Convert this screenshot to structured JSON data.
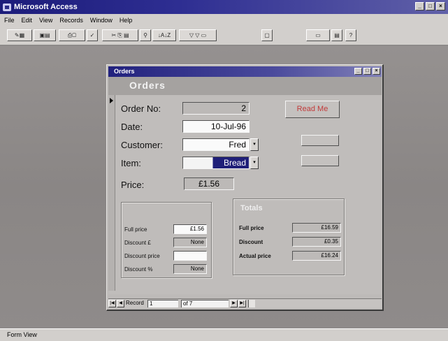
{
  "app": {
    "title": "Microsoft Access",
    "menu": [
      "File",
      "Edit",
      "View",
      "Records",
      "Window",
      "Help"
    ],
    "status": "Form View"
  },
  "form": {
    "window_title": "Orders",
    "header_title": "Orders",
    "fields": {
      "order_no": {
        "label": "Order No:",
        "value": "2"
      },
      "date": {
        "label": "Date:",
        "value": "10-Jul-96"
      },
      "customer": {
        "label": "Customer:",
        "value": "Fred"
      },
      "item": {
        "label": "Item:",
        "value": "Bread"
      },
      "price": {
        "label": "Price:",
        "value": "£1.56"
      }
    },
    "read_me_label": "Read Me",
    "left_group": {
      "rows": [
        {
          "label": "Full price",
          "value": "£1.56"
        },
        {
          "label": "Discount £",
          "value": "None"
        },
        {
          "label": "Discount price",
          "value": ""
        },
        {
          "label": "Discount %",
          "value": "None"
        }
      ]
    },
    "totals": {
      "title": "Totals",
      "rows": [
        {
          "label": "Full price",
          "value": "£16.59"
        },
        {
          "label": "Discount",
          "value": "£0.35"
        },
        {
          "label": "Actual price",
          "value": "£16.24"
        }
      ]
    },
    "navigation": {
      "record_label": "Record",
      "current": "1",
      "of_text": "of 7"
    }
  },
  "colors": {
    "title_bar": "#1c1c7a",
    "workspace": "#8e8b8a",
    "form_bg": "#c0bdbb",
    "read_me_text": "#c23a3a"
  }
}
